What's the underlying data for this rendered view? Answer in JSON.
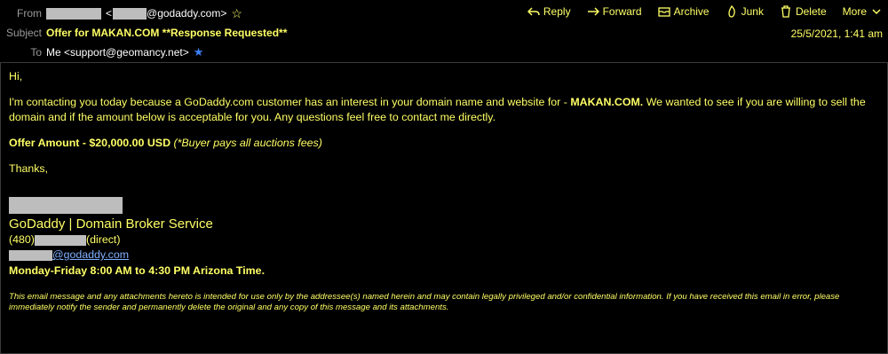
{
  "header": {
    "from_label": "From",
    "from_open": "<",
    "from_email_suffix": "@godaddy.com>",
    "subject_label": "Subject",
    "subject": "Offer for MAKAN.COM **Response Requested**",
    "to_label": "To",
    "to_value": "Me <support@geomancy.net>",
    "date": "25/5/2021, 1:41 am"
  },
  "toolbar": {
    "reply": "Reply",
    "forward": "Forward",
    "archive": "Archive",
    "junk": "Junk",
    "delete": "Delete",
    "more": "More"
  },
  "message": {
    "greeting": "Hi,",
    "para1_a": "I'm contacting you today because a GoDaddy.com customer has an interest in your domain name and website for -  ",
    "para1_domain": "MAKAN.COM.",
    "para1_b": " We wanted to see if you are willing to sell the domain and if the amount below is acceptable for you.  Any questions feel free to contact me directly.",
    "offer": "Offer Amount - $20,000.00  USD ",
    "offer_note": "(*Buyer pays all auctions fees)",
    "thanks": "Thanks,"
  },
  "signature": {
    "title": "GoDaddy | Domain Broker Service",
    "phone_prefix": "(480)",
    "phone_suffix": "(direct)",
    "email_suffix": "@godaddy.com",
    "hours": "Monday-Friday 8:00 AM to 4:30 PM Arizona Time."
  },
  "disclaimer": "This email message and any attachments hereto is intended for use only by the addressee(s) named herein and may contain legally privileged and/or confidential information. If you have received this email in error, please immediately notify the sender and permanently delete the original and any copy of this message and its attachments.",
  "colors": {
    "background": "#000000",
    "text": "#ffff66",
    "link": "#7fb0ff",
    "redaction": "#bdbdbd"
  },
  "icons": [
    "star-icon",
    "reply-icon",
    "forward-icon",
    "archive-icon",
    "junk-icon",
    "delete-icon",
    "chevron-down-icon",
    "blue-star-icon"
  ]
}
